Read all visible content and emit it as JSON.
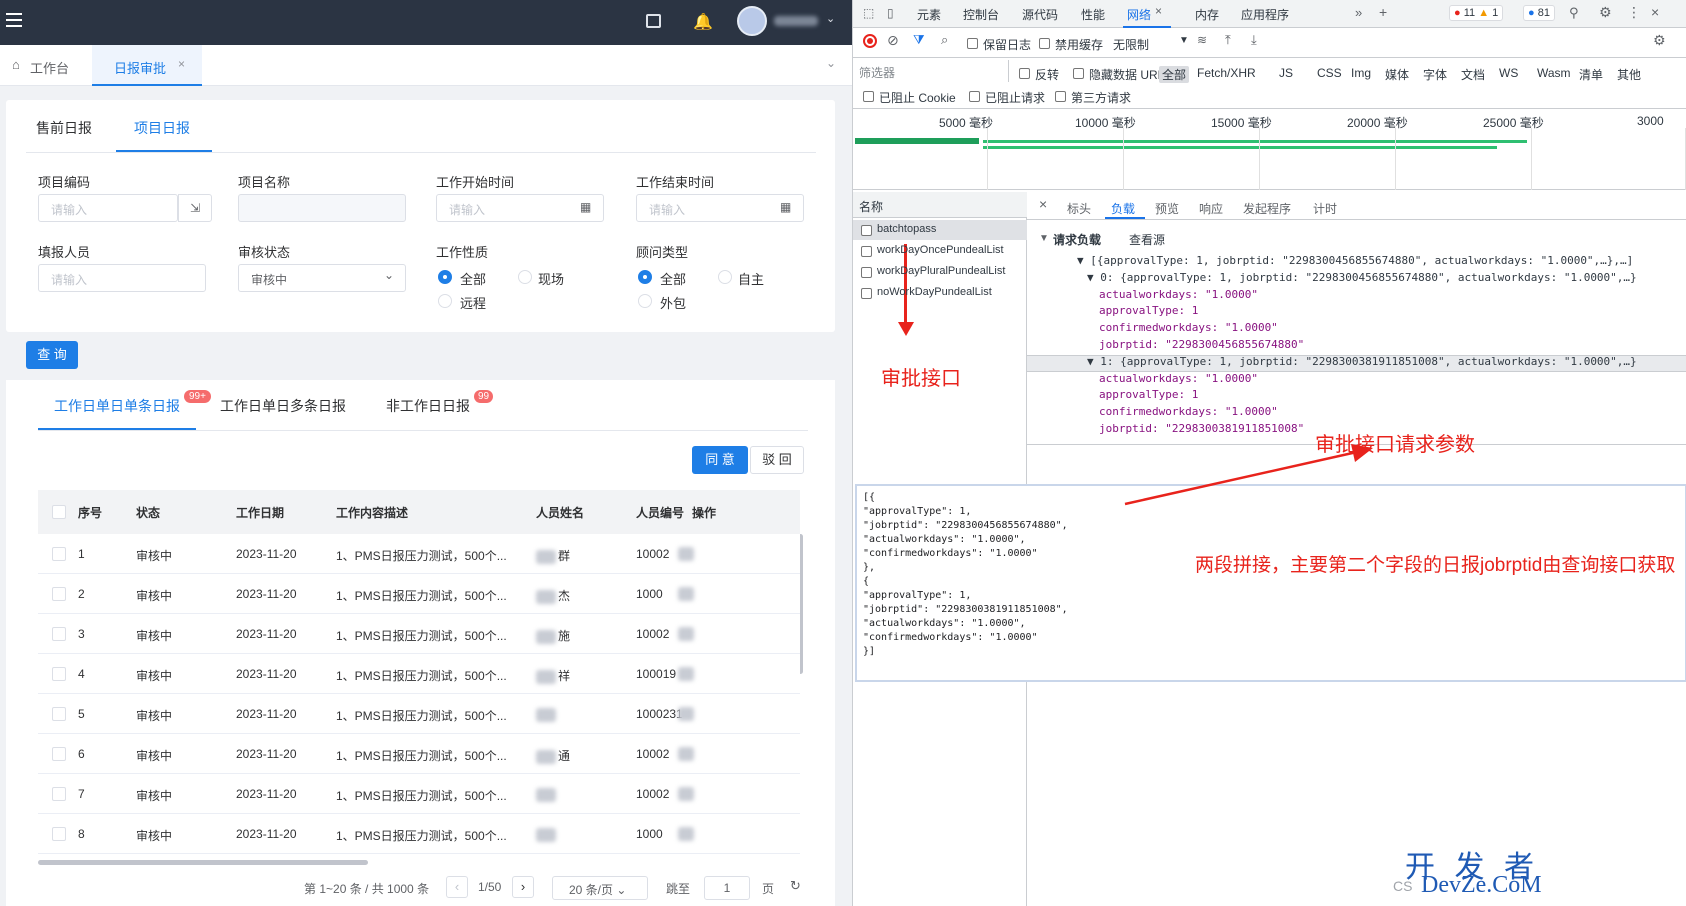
{
  "app": {
    "breadcrumb_home": "工作台",
    "active_tab": "日报审批",
    "sub_tabs": [
      "售前日报",
      "项目日报"
    ],
    "filters": {
      "project_code": {
        "label": "项目编码",
        "placeholder": "请输入"
      },
      "project_name": {
        "label": "项目名称"
      },
      "start_time": {
        "label": "工作开始时间",
        "placeholder": "请输入"
      },
      "end_time": {
        "label": "工作结束时间",
        "placeholder": "请输入"
      },
      "reporter": {
        "label": "填报人员",
        "placeholder": "请输入"
      },
      "review_status": {
        "label": "审核状态",
        "value": "审核中"
      },
      "work_nature": {
        "label": "工作性质",
        "options": [
          "全部",
          "现场",
          "远程"
        ]
      },
      "consultant_type": {
        "label": "顾问类型",
        "options": [
          "全部",
          "自主",
          "外包"
        ]
      }
    },
    "query_button": "查 询",
    "report_tabs": [
      {
        "label": "工作日单日单条日报",
        "badge": "99+"
      },
      {
        "label": "工作日单日多条日报",
        "badge": ""
      },
      {
        "label": "非工作日日报",
        "badge": "99"
      }
    ],
    "agree_button": "同 意",
    "reject_button": "驳 回",
    "table": {
      "headers": [
        "序号",
        "状态",
        "工作日期",
        "工作内容描述",
        "人员姓名",
        "人员编号",
        "操作"
      ],
      "rows": [
        {
          "no": "1",
          "status": "审核中",
          "date": "2023-11-20",
          "desc": "1、PMS日报压力测试，500个...",
          "name": "群",
          "code": "10002"
        },
        {
          "no": "2",
          "status": "审核中",
          "date": "2023-11-20",
          "desc": "1、PMS日报压力测试，500个...",
          "name": "杰",
          "code": "1000"
        },
        {
          "no": "3",
          "status": "审核中",
          "date": "2023-11-20",
          "desc": "1、PMS日报压力测试，500个...",
          "name": "施",
          "code": "10002"
        },
        {
          "no": "4",
          "status": "审核中",
          "date": "2023-11-20",
          "desc": "1、PMS日报压力测试，500个...",
          "name": "祥",
          "code": "100019"
        },
        {
          "no": "5",
          "status": "审核中",
          "date": "2023-11-20",
          "desc": "1、PMS日报压力测试，500个...",
          "name": "",
          "code": "1000231"
        },
        {
          "no": "6",
          "status": "审核中",
          "date": "2023-11-20",
          "desc": "1、PMS日报压力测试，500个...",
          "name": "通",
          "code": "10002"
        },
        {
          "no": "7",
          "status": "审核中",
          "date": "2023-11-20",
          "desc": "1、PMS日报压力测试，500个...",
          "name": "",
          "code": "10002"
        },
        {
          "no": "8",
          "status": "审核中",
          "date": "2023-11-20",
          "desc": "1、PMS日报压力测试，500个...",
          "name": "",
          "code": "1000"
        }
      ]
    },
    "pagination": {
      "summary": "第 1~20 条 / 共 1000 条",
      "page": "1/50",
      "page_size": "20 条/页",
      "jump_label": "跳至",
      "jump_value": "1",
      "page_unit": "页"
    }
  },
  "devtools": {
    "tabs": [
      "元素",
      "控制台",
      "源代码",
      "性能",
      "网络",
      "内存",
      "应用程序"
    ],
    "active_tab": "网络",
    "counts": {
      "errors": "11",
      "warnings": "1",
      "info": "81"
    },
    "toolbar": {
      "preserve_log": "保留日志",
      "disable_cache": "禁用缓存",
      "throttle": "无限制"
    },
    "filter_placeholder": "筛选器",
    "filter_opts": [
      "反转",
      "隐藏数据 URL"
    ],
    "type_filters": [
      "全部",
      "Fetch/XHR",
      "JS",
      "CSS",
      "Img",
      "媒体",
      "字体",
      "文档",
      "WS",
      "Wasm",
      "清单",
      "其他"
    ],
    "filter_opts2": [
      "已阻止 Cookie",
      "已阻止请求",
      "第三方请求"
    ],
    "timeline": [
      "5000 毫秒",
      "10000 毫秒",
      "15000 毫秒",
      "20000 毫秒",
      "25000 毫秒",
      "3000"
    ],
    "name_header": "名称",
    "requests": [
      "batchtopass",
      "workDayOncePundealList",
      "workDayPluralPundealList",
      "noWorkDayPundealList"
    ],
    "detail_tabs": [
      "标头",
      "负载",
      "预览",
      "响应",
      "发起程序",
      "计时"
    ],
    "payload_title": "请求负载",
    "view_source": "查看源",
    "payload_lines": [
      "▼ [{approvalType: 1, jobrptid: \"2298300456855674880\", actualworkdays: \"1.0000\",…},…]",
      "▼ 0: {approvalType: 1, jobrptid: \"2298300456855674880\", actualworkdays: \"1.0000\",…}",
      "actualworkdays: \"1.0000\"",
      "approvalType: 1",
      "confirmedworkdays: \"1.0000\"",
      "jobrptid: \"2298300456855674880\"",
      "▼ 1: {approvalType: 1, jobrptid: \"2298300381911851008\", actualworkdays: \"1.0000\",…}",
      "actualworkdays: \"1.0000\"",
      "approvalType: 1",
      "confirmedworkdays: \"1.0000\"",
      "jobrptid: \"2298300381911851008\""
    ],
    "json_lines": [
      "[{",
      "    \"approvalType\": 1,",
      "    \"jobrptid\": \"2298300456855674880\",",
      "    \"actualworkdays\": \"1.0000\",",
      "    \"confirmedworkdays\": \"1.0000\"",
      "},",
      "{",
      "    \"approvalType\": 1,",
      "    \"jobrptid\": \"2298300381911851008\",",
      "    \"actualworkdays\": \"1.0000\",",
      "    \"confirmedworkdays\": \"1.0000\"",
      "}]"
    ]
  },
  "annotations": {
    "api": "审批接口",
    "params": "审批接口请求参数",
    "note": "两段拼接，主要第二个字段的日报jobrptid由查询接口获取",
    "watermark_cn": "开 发 者",
    "watermark_en": "DevZe.CoM",
    "watermark_cs": "CS"
  }
}
